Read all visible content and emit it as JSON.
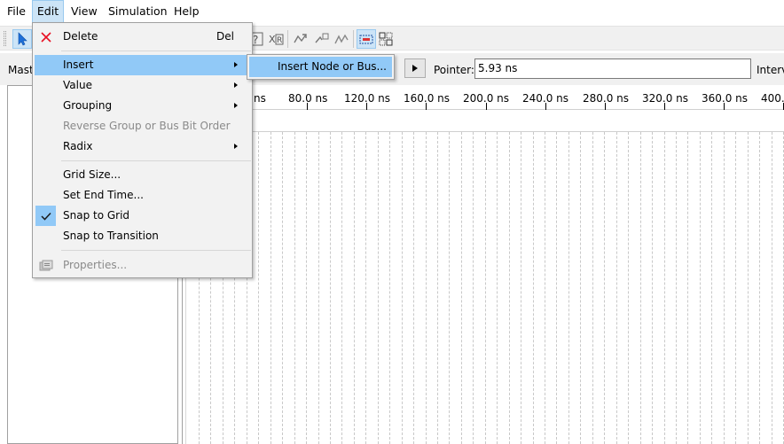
{
  "menubar": {
    "items": [
      {
        "label": "File"
      },
      {
        "label": "Edit"
      },
      {
        "label": "View"
      },
      {
        "label": "Simulation"
      },
      {
        "label": "Help"
      }
    ]
  },
  "panel": {
    "master_label": "Mast",
    "pointer_label": "Pointer:",
    "pointer_value": "5.93 ns",
    "interval_label": "Interv"
  },
  "ruler": {
    "ticks": [
      "ns",
      "80.0 ns",
      "120.0 ns",
      "160.0 ns",
      "200.0 ns",
      "240.0 ns",
      "280.0 ns",
      "320.0 ns",
      "360.0 ns",
      "400.0"
    ]
  },
  "edit_menu": {
    "delete": {
      "label": "Delete",
      "shortcut": "Del",
      "icon": "close-icon",
      "icon_color": "#e81123"
    },
    "insert": {
      "label": "Insert"
    },
    "value": {
      "label": "Value"
    },
    "grouping": {
      "label": "Grouping"
    },
    "reverse": {
      "label": "Reverse Group or Bus Bit Order"
    },
    "radix": {
      "label": "Radix"
    },
    "grid_size": {
      "label": "Grid Size..."
    },
    "set_end_time": {
      "label": "Set End Time..."
    },
    "snap_to_grid": {
      "label": "Snap to Grid",
      "checked": true
    },
    "snap_to_transition": {
      "label": "Snap to Transition"
    },
    "properties": {
      "label": "Properties..."
    }
  },
  "insert_submenu": {
    "insert_node": {
      "label": "Insert Node or Bus..."
    }
  },
  "colors": {
    "highlight": "#91c9f7",
    "menubar_active": "#cce4f7",
    "toolbar_bg": "#f0f0f0"
  }
}
